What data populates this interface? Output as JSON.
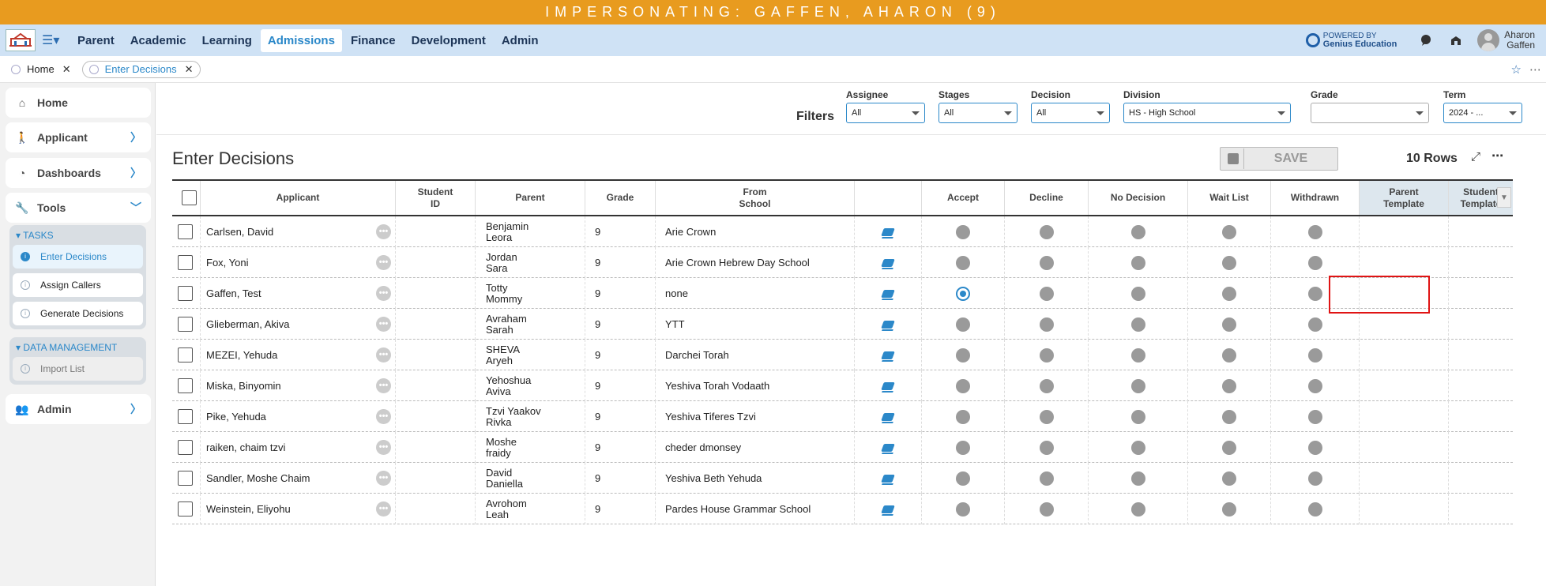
{
  "banner": {
    "text": "IMPERSONATING: GAFFEN, AHARON (9)"
  },
  "nav": {
    "tabs": [
      "Parent",
      "Academic",
      "Learning",
      "Admissions",
      "Finance",
      "Development",
      "Admin"
    ],
    "active_tab": "Admissions",
    "powered_by": "POWERED BY",
    "powered_brand": "Genius Education",
    "user_first": "Aharon",
    "user_last": "Gaffen"
  },
  "open_tabs": [
    {
      "label": "Home",
      "close": "✕"
    },
    {
      "label": "Enter Decisions",
      "close": "✕"
    }
  ],
  "sidebar": {
    "home": "Home",
    "applicant": "Applicant",
    "dashboards": "Dashboards",
    "tools": "Tools",
    "tasks_title": "TASKS",
    "tasks": [
      "Enter Decisions",
      "Assign Callers",
      "Generate Decisions"
    ],
    "data_mgmt_title": "DATA MANAGEMENT",
    "data_mgmt": [
      "Import List"
    ],
    "admin": "Admin"
  },
  "filters": {
    "label": "Filters",
    "assignee": {
      "label": "Assignee",
      "value": "All"
    },
    "stages": {
      "label": "Stages",
      "value": "All"
    },
    "decision": {
      "label": "Decision",
      "value": "All"
    },
    "division": {
      "label": "Division",
      "value": "HS - High School"
    },
    "grade": {
      "label": "Grade",
      "value": ""
    },
    "term": {
      "label": "Term",
      "value": "2024 - ..."
    }
  },
  "page": {
    "title": "Enter Decisions",
    "save_label": "SAVE",
    "rows_count": "10 Rows"
  },
  "columns": {
    "applicant": "Applicant",
    "student_id_1": "Student",
    "student_id_2": "ID",
    "parent": "Parent",
    "grade": "Grade",
    "from_school_1": "From",
    "from_school_2": "School",
    "accept": "Accept",
    "decline": "Decline",
    "no_decision": "No Decision",
    "wait_list": "Wait List",
    "withdrawn": "Withdrawn",
    "parent_template_1": "Parent",
    "parent_template_2": "Template",
    "student_template_1": "Student",
    "student_template_2": "Template"
  },
  "rows": [
    {
      "applicant": "Carlsen, David",
      "parent1": "Benjamin",
      "parent2": "Leora",
      "grade": "9",
      "school": "Arie Crown",
      "decision": ""
    },
    {
      "applicant": "Fox, Yoni",
      "parent1": "Jordan",
      "parent2": "Sara",
      "grade": "9",
      "school": "Arie Crown Hebrew Day School",
      "decision": ""
    },
    {
      "applicant": "Gaffen, Test",
      "parent1": "Totty",
      "parent2": "Mommy",
      "grade": "9",
      "school": "none",
      "decision": "accept"
    },
    {
      "applicant": "Glieberman, Akiva",
      "parent1": "Avraham",
      "parent2": "Sarah",
      "grade": "9",
      "school": "YTT",
      "decision": ""
    },
    {
      "applicant": "MEZEI, Yehuda",
      "parent1": "SHEVA",
      "parent2": "Aryeh",
      "grade": "9",
      "school": "Darchei Torah",
      "decision": ""
    },
    {
      "applicant": "Miska, Binyomin",
      "parent1": "Yehoshua",
      "parent2": "Aviva",
      "grade": "9",
      "school": "Yeshiva Torah Vodaath",
      "decision": ""
    },
    {
      "applicant": "Pike, Yehuda",
      "parent1": "Tzvi Yaakov",
      "parent2": "Rivka",
      "grade": "9",
      "school": "Yeshiva Tiferes Tzvi",
      "decision": ""
    },
    {
      "applicant": "raiken, chaim tzvi",
      "parent1": "Moshe",
      "parent2": "fraidy",
      "grade": "9",
      "school": "cheder dmonsey",
      "decision": ""
    },
    {
      "applicant": "Sandler, Moshe Chaim",
      "parent1": "David",
      "parent2": "Daniella",
      "grade": "9",
      "school": "Yeshiva Beth Yehuda",
      "decision": ""
    },
    {
      "applicant": "Weinstein, Eliyohu",
      "parent1": "Avrohom",
      "parent2": "Leah",
      "grade": "9",
      "school": "Pardes House Grammar School",
      "decision": ""
    }
  ],
  "colors": {
    "banner": "#e89b1f",
    "nav": "#cfe2f5",
    "accent": "#2b88c9"
  }
}
